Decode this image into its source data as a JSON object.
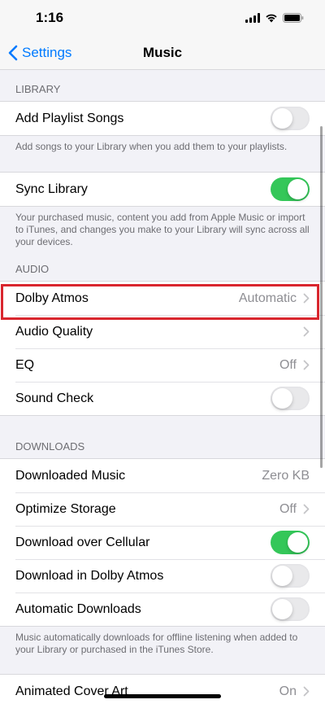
{
  "status_bar": {
    "time": "1:16"
  },
  "nav": {
    "back_label": "Settings",
    "title": "Music"
  },
  "library": {
    "header": "LIBRARY",
    "add_playlist_songs": {
      "label": "Add Playlist Songs",
      "on": false
    },
    "add_playlist_footer": "Add songs to your Library when you add them to your playlists.",
    "sync_library": {
      "label": "Sync Library",
      "on": true
    },
    "sync_footer": "Your purchased music, content you add from Apple Music or import to iTunes, and changes you make to your Library will sync across all your devices."
  },
  "audio": {
    "header": "AUDIO",
    "dolby_atmos": {
      "label": "Dolby Atmos",
      "value": "Automatic"
    },
    "audio_quality": {
      "label": "Audio Quality"
    },
    "eq": {
      "label": "EQ",
      "value": "Off"
    },
    "sound_check": {
      "label": "Sound Check",
      "on": false
    }
  },
  "downloads": {
    "header": "DOWNLOADS",
    "downloaded_music": {
      "label": "Downloaded Music",
      "value": "Zero KB"
    },
    "optimize_storage": {
      "label": "Optimize Storage",
      "value": "Off"
    },
    "download_cellular": {
      "label": "Download over Cellular",
      "on": true
    },
    "download_dolby": {
      "label": "Download in Dolby Atmos",
      "on": false
    },
    "automatic_downloads": {
      "label": "Automatic Downloads",
      "on": false
    },
    "footer": "Music automatically downloads for offline listening when added to your Library or purchased in the iTunes Store."
  },
  "animated_cover_art": {
    "label": "Animated Cover Art",
    "value": "On"
  },
  "colors": {
    "accent": "#007aff",
    "toggle_on": "#34c759",
    "highlight": "#d9262e"
  }
}
